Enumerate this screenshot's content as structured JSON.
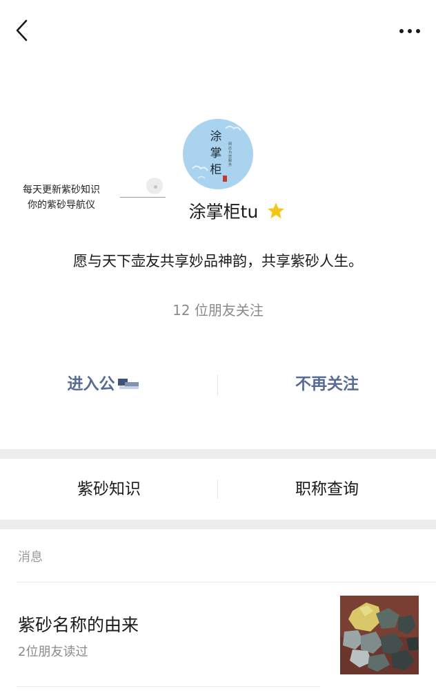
{
  "topbar": {
    "back_icon": "chevron-left-icon",
    "more_icon": "more-dots-icon"
  },
  "avatar": {
    "glyphs": "涂掌柜",
    "side_text": "网店为您服务"
  },
  "slogan": {
    "line1": "每天更新紫砂知识",
    "line2": "你的紫砂导航仪"
  },
  "profile": {
    "name": "涂掌柜tu",
    "badge_icon": "star-icon",
    "intro": "愿与天下壶友共享妙品神韵，共享紫砂人生。",
    "followers": "12 位朋友关注"
  },
  "actions": {
    "enter_label": "进入公",
    "unfollow_label": "不再关注"
  },
  "menu": {
    "item1": "紫砂知识",
    "item2": "职称查询"
  },
  "messages": {
    "section_title": "消息",
    "article_title": "紫砂名称的由来",
    "article_meta": "2位朋友读过"
  },
  "colors": {
    "link": "#586b95",
    "muted": "#8a8a8a",
    "separator": "#ededed",
    "star": "#f5c518",
    "avatar_bg": "#a9d3ee"
  }
}
